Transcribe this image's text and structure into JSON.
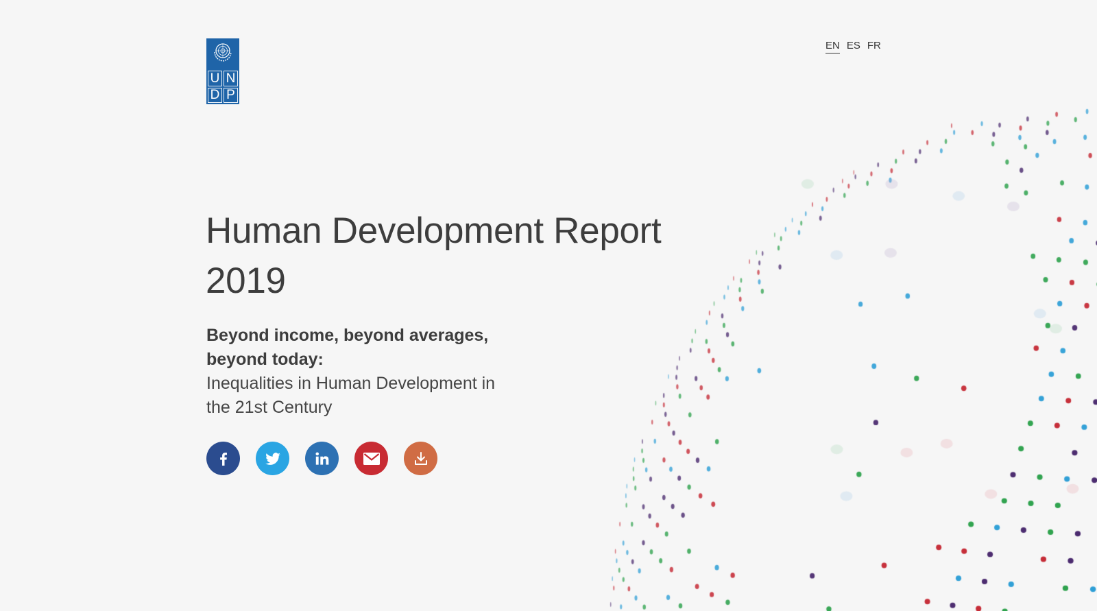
{
  "brand": {
    "name": "UNDP",
    "letters": [
      "U",
      "N",
      "D",
      "P"
    ],
    "color": "#1f64a8"
  },
  "languages": [
    {
      "code": "EN",
      "active": true
    },
    {
      "code": "ES",
      "active": false
    },
    {
      "code": "FR",
      "active": false
    }
  ],
  "hero": {
    "title_line1": "Human Development Report",
    "title_line2": "2019",
    "subtitle_bold_line1": "Beyond income, beyond averages,",
    "subtitle_bold_line2": "beyond today:",
    "subtitle_line3": "Inequalities in Human Development in",
    "subtitle_line4": "the 21st Century"
  },
  "share_buttons": [
    {
      "name": "facebook",
      "icon": "facebook-icon",
      "color": "#2b4c8f"
    },
    {
      "name": "twitter",
      "icon": "twitter-icon",
      "color": "#2aa5e3"
    },
    {
      "name": "linkedin",
      "icon": "linkedin-icon",
      "color": "#2d71b3"
    },
    {
      "name": "email",
      "icon": "envelope-icon",
      "color": "#c82b33"
    },
    {
      "name": "download",
      "icon": "download-icon",
      "color": "#d06c44"
    }
  ],
  "globe": {
    "dot_colors": [
      "#2f9fd6",
      "#2ea24d",
      "#c52a35",
      "#4a2a6e"
    ]
  }
}
